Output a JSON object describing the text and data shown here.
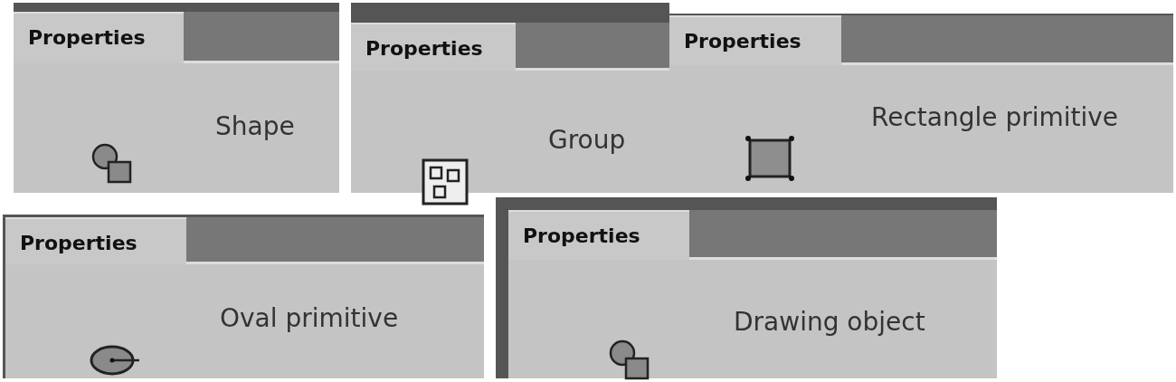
{
  "panels": [
    {
      "tab": {
        "label": "Properties",
        "selected": true
      },
      "object_type": "Shape",
      "icon": {
        "kind": "shape"
      }
    },
    {
      "tab": {
        "label": "Properties",
        "selected": true
      },
      "object_type": "Group",
      "icon": {
        "kind": "group"
      }
    },
    {
      "tab": {
        "label": "Properties",
        "selected": true
      },
      "object_type": "Rectangle primitive",
      "icon": {
        "kind": "rectangle"
      }
    },
    {
      "tab": {
        "label": "Properties",
        "selected": true
      },
      "object_type": "Oval primitive",
      "icon": {
        "kind": "oval"
      }
    },
    {
      "tab": {
        "label": "Properties",
        "selected": true
      },
      "object_type": "Drawing object",
      "icon": {
        "kind": "shape"
      }
    }
  ]
}
